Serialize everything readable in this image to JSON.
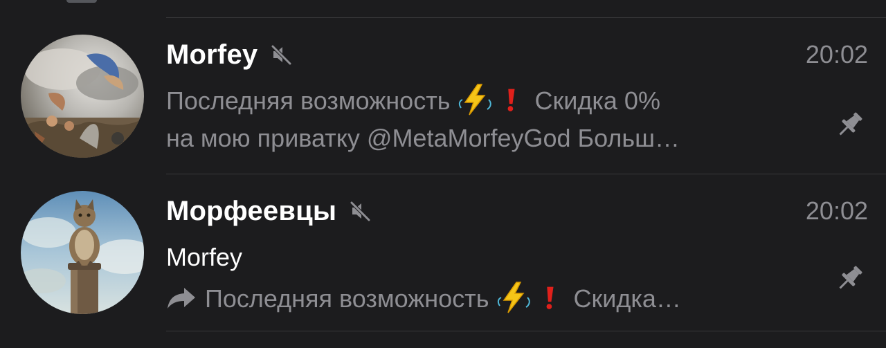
{
  "chats": [
    {
      "title": "Morfey",
      "time": "20:02",
      "muted": true,
      "pinned": true,
      "avatar": "baroque-painting-avatar",
      "preview_part1": "Последняя возможность",
      "preview_part2": "Скидка 0%",
      "preview_line2": "на мою приватку @MetaMorfeyGod Больш…"
    },
    {
      "title": "Морфеевцы",
      "time": "20:02",
      "muted": true,
      "pinned": true,
      "avatar": "cat-on-pillar-avatar",
      "sender": "Morfey",
      "preview_part1": "Последняя возможность",
      "preview_part2": "Скидка…"
    }
  ],
  "icons": {
    "mute": "muted-speaker-icon",
    "pin": "pin-icon",
    "forward": "forward-arrow-icon",
    "emoji_1": "high-voltage-emoji",
    "emoji_2": "exclamation-emoji"
  },
  "colors": {
    "background": "#1c1c1e",
    "primary_text": "#ffffff",
    "secondary_text": "#8e8e93",
    "divider": "#38383a",
    "emoji_lightning": "#f5c518",
    "emoji_exclamation": "#e0201b"
  }
}
